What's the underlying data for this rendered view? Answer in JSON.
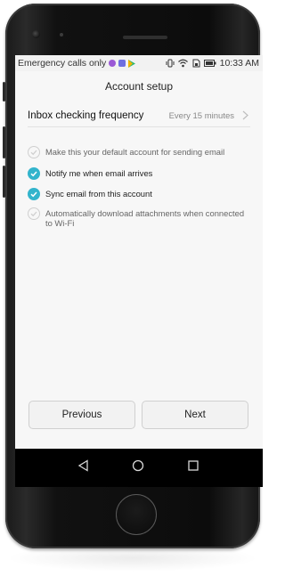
{
  "status_bar": {
    "left_text": "Emergency calls only",
    "left_icons": [
      "notification-icon",
      "gallery-icon",
      "play-store-icon"
    ],
    "right_icons": [
      "vibrate-icon",
      "wifi-icon",
      "sim-icon",
      "battery-icon"
    ],
    "time": "10:33 AM"
  },
  "header": {
    "title": "Account setup"
  },
  "frequency": {
    "label": "Inbox checking frequency",
    "value": "Every 15 minutes"
  },
  "options": [
    {
      "label": "Make this your default account for sending email",
      "checked": false
    },
    {
      "label": "Notify me when email arrives",
      "checked": true
    },
    {
      "label": "Sync email from this account",
      "checked": true
    },
    {
      "label": "Automatically download attachments when connected to Wi-Fi",
      "checked": false
    }
  ],
  "buttons": {
    "previous": "Previous",
    "next": "Next"
  },
  "nav": {
    "icons": [
      "back-icon",
      "home-icon",
      "recents-icon"
    ]
  },
  "colors": {
    "accent": "#33b4cc",
    "screen_bg": "#f7f7f7",
    "nav_bg": "#000000"
  }
}
